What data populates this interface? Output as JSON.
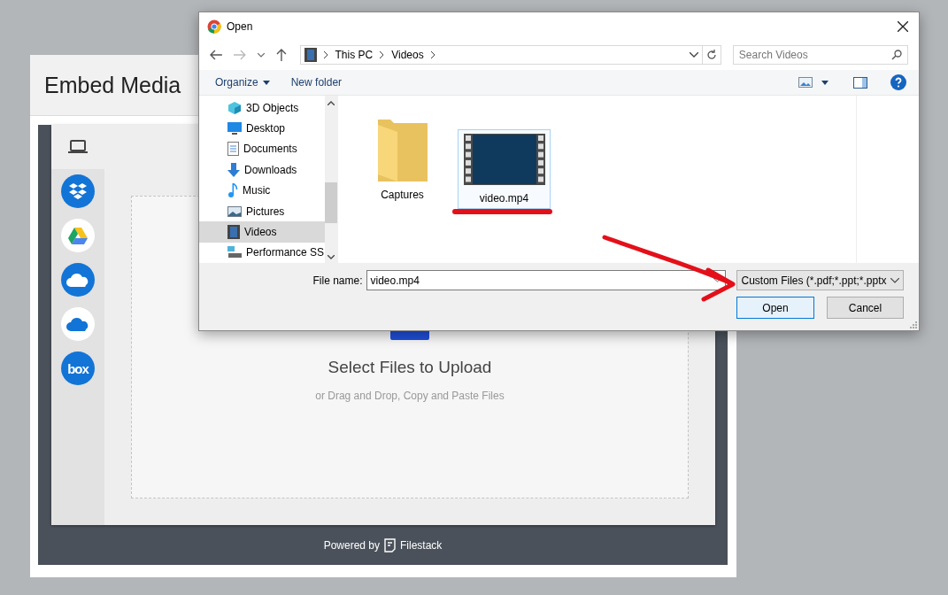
{
  "embed_modal": {
    "title": "Embed Media"
  },
  "picker": {
    "sources": [
      {
        "kind": "dropbox"
      },
      {
        "kind": "google-drive"
      },
      {
        "kind": "onedrive"
      },
      {
        "kind": "onedrive-business"
      },
      {
        "kind": "box",
        "label": "box"
      }
    ],
    "upload_title": "Select Files to Upload",
    "upload_hint": "or Drag and Drop, Copy and Paste Files",
    "footer": {
      "powered_by": "Powered by",
      "brand": "Filestack"
    }
  },
  "open_dialog": {
    "title": "Open",
    "breadcrumb": [
      "This PC",
      "Videos"
    ],
    "search": {
      "placeholder": "Search Videos"
    },
    "commands": [
      "Organize",
      "New folder"
    ],
    "nav_items": [
      {
        "label": "3D Objects",
        "kind": "cube",
        "selected": false
      },
      {
        "label": "Desktop",
        "kind": "desktop",
        "selected": false
      },
      {
        "label": "Documents",
        "kind": "document",
        "selected": false
      },
      {
        "label": "Downloads",
        "kind": "download",
        "selected": false
      },
      {
        "label": "Music",
        "kind": "music",
        "selected": false
      },
      {
        "label": "Pictures",
        "kind": "picture",
        "selected": false
      },
      {
        "label": "Videos",
        "kind": "video",
        "selected": true
      },
      {
        "label": "Performance SS",
        "kind": "drive",
        "selected": false
      }
    ],
    "files": [
      {
        "name": "Captures",
        "kind": "folder",
        "selected": false
      },
      {
        "name": "video.mp4",
        "kind": "video",
        "selected": true
      }
    ],
    "file_name": {
      "label": "File name:",
      "value": "video.mp4"
    },
    "file_type": "Custom Files (*.pdf;*.ppt;*.pptx",
    "buttons": [
      {
        "label": "Open",
        "default": true
      },
      {
        "label": "Cancel",
        "default": false
      }
    ]
  }
}
